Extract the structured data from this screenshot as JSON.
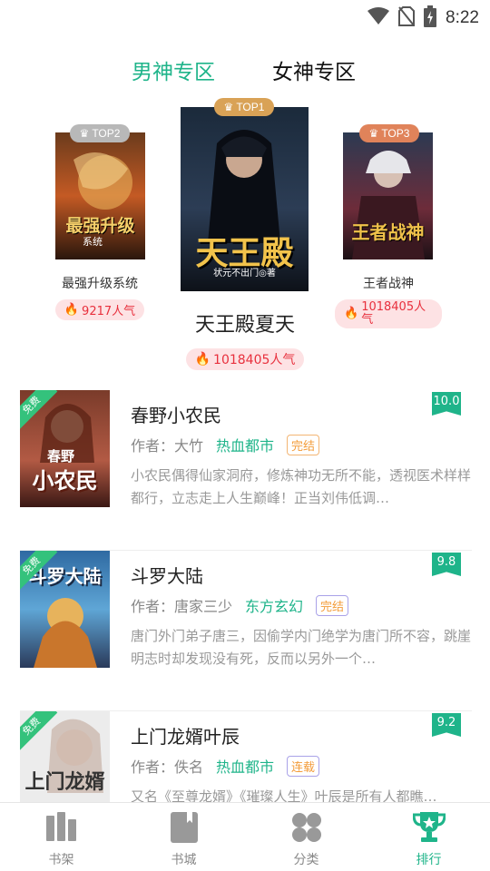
{
  "status_bar": {
    "time": "8:22",
    "icons": [
      "wifi-icon",
      "no-sim-icon",
      "battery-charging-icon"
    ]
  },
  "tabs": {
    "male": "男神专区",
    "female": "女神专区",
    "active": "male"
  },
  "podium": {
    "first": {
      "rank": "TOP1",
      "title": "天王殿夏天",
      "popularity": "1018405人气",
      "cover_text": "天王殿",
      "cover_author": "状元不出门◎著"
    },
    "second": {
      "rank": "TOP2",
      "title": "最强升级系统",
      "popularity": "9217人气",
      "cover_text": "最强升级",
      "cover_sub": "系统"
    },
    "third": {
      "rank": "TOP3",
      "title": "王者战神",
      "popularity": "1018405人气",
      "cover_text": "王者战神"
    }
  },
  "books": [
    {
      "title": "春野小农民",
      "author": "作者：大竹",
      "genre": "热血都市",
      "status": "完结",
      "score": "10.0",
      "free": "免费",
      "desc": "小农民偶得仙家洞府，修炼神功无所不能，透视医术样样都行，立志走上人生巅峰！正当刘伟低调…",
      "cover_text": "小农民",
      "cover_top": "春野"
    },
    {
      "title": "斗罗大陆",
      "author": "作者：唐家三少",
      "genre": "东方玄幻",
      "status": "完结",
      "score": "9.8",
      "free": "免费",
      "desc": "唐门外门弟子唐三，因偷学内门绝学为唐门所不容，跳崖明志时却发现没有死，反而以另外一个…",
      "cover_text": "斗罗大陆"
    },
    {
      "title": "上门龙婿叶辰",
      "author": "作者：佚名",
      "genre": "热血都市",
      "status": "连载",
      "score": "9.2",
      "free": "免费",
      "desc": "又名《至尊龙婿》《璀璨人生》叶辰是所有人都瞧…",
      "cover_text": "上门龙婿"
    }
  ],
  "nav": [
    {
      "label": "书架",
      "icon": "bookshelf-icon",
      "active": false
    },
    {
      "label": "书城",
      "icon": "book-icon",
      "active": false
    },
    {
      "label": "分类",
      "icon": "category-icon",
      "active": false
    },
    {
      "label": "排行",
      "icon": "trophy-icon",
      "active": true
    }
  ],
  "colors": {
    "accent": "#1fb48a",
    "popularity": "#e8303d",
    "popularity_bg": "#fde2e4",
    "top1": "#d9a256",
    "top2": "#b8b8b8",
    "top3": "#e0835a"
  }
}
